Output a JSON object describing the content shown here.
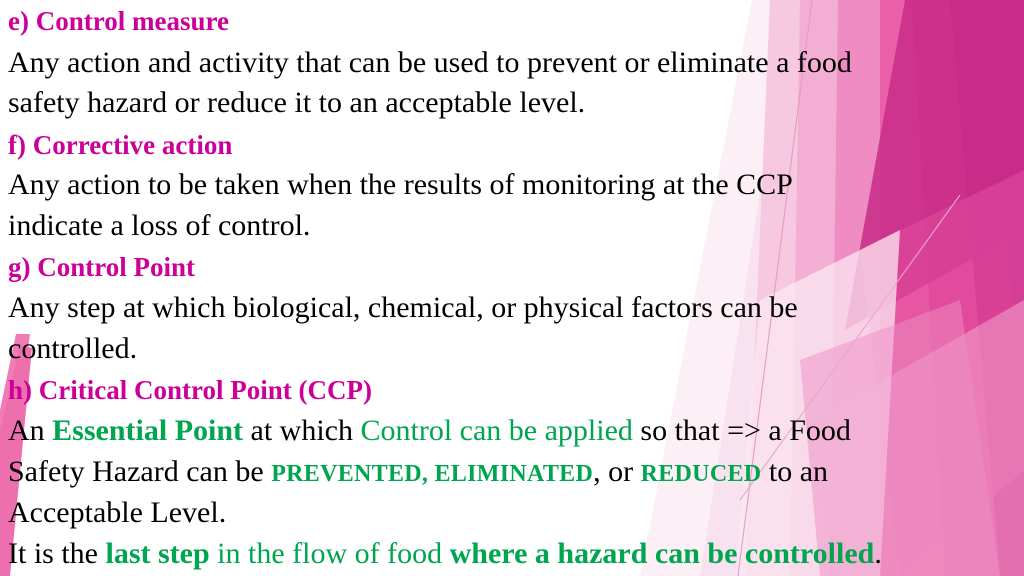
{
  "slide": {
    "background_color": "#ffffff",
    "heading_color": "#CC0099",
    "body_color": "#000000",
    "accent_green": "#00A550",
    "decoration_colors": {
      "pale_pink": "#F7DCEA",
      "light_pink": "#F4AFD2",
      "mid_pink": "#EE8CC3",
      "pink": "#E85FA9",
      "hot_pink": "#E0469C",
      "magenta": "#D52F90",
      "deep_magenta": "#C42A8A",
      "dark_magenta": "#BA1F80",
      "hairline": "#E6A9C8",
      "left_wedge": "#F07CB5"
    }
  },
  "lines": [
    {
      "id": "line-e-heading",
      "name": "heading-control-measure",
      "type": "heading",
      "text": "e) Control measure"
    },
    {
      "id": "line-e-body-1",
      "name": "body-control-measure-1",
      "type": "body",
      "text": " Any action and activity that can be used to prevent or eliminate a food"
    },
    {
      "id": "line-e-body-2",
      "name": "body-control-measure-2",
      "type": "body",
      "text": "safety hazard or reduce it to an acceptable level."
    },
    {
      "id": "line-f-heading",
      "name": "heading-corrective-action",
      "type": "heading",
      "text": "f) Corrective action"
    },
    {
      "id": "line-f-body-1",
      "name": "body-corrective-action-1",
      "type": "body",
      "text": "Any action to be taken when the results of monitoring at the CCP"
    },
    {
      "id": "line-f-body-2",
      "name": "body-corrective-action-2",
      "type": "body",
      "text": "indicate a loss of control."
    },
    {
      "id": "line-g-heading",
      "name": "heading-control-point",
      "type": "heading",
      "text": "g) Control Point"
    },
    {
      "id": "line-g-body-1",
      "name": "body-control-point-1",
      "type": "body",
      "text": "Any step at which biological, chemical, or physical factors can be"
    },
    {
      "id": "line-g-body-2",
      "name": "body-control-point-2",
      "type": "body",
      "text": "controlled."
    },
    {
      "id": "line-h-heading",
      "name": "heading-critical-control-point",
      "type": "heading",
      "text": "h) Critical Control Point (CCP)"
    }
  ],
  "rich_lines": {
    "ccp_line_1": {
      "name": "body-ccp-essential-point",
      "segments": [
        {
          "text": "An ",
          "style": "plain"
        },
        {
          "text": "Essential Point",
          "style": "green-bold"
        },
        {
          "text": " at which ",
          "style": "plain"
        },
        {
          "text": "Control can be applied",
          "style": "green"
        },
        {
          "text": " so that => a Food",
          "style": "plain"
        }
      ]
    },
    "ccp_line_2": {
      "name": "body-ccp-hazard-actions",
      "segments": [
        {
          "text": "Safety Hazard can be ",
          "style": "plain"
        },
        {
          "text": "PREVENTED, ELIMINATED",
          "style": "green-smallcaps"
        },
        {
          "text": ", or ",
          "style": "plain"
        },
        {
          "text": "REDUCED",
          "style": "green-smallcaps"
        },
        {
          "text": " to an",
          "style": "plain"
        }
      ]
    },
    "ccp_line_3": {
      "name": "body-ccp-acceptable-level",
      "segments": [
        {
          "text": "Acceptable Level.",
          "style": "plain"
        }
      ]
    },
    "ccp_line_4": {
      "name": "body-ccp-last-step",
      "segments": [
        {
          "text": "It is the ",
          "style": "plain"
        },
        {
          "text": "last step",
          "style": "green-bold"
        },
        {
          "text": " in the flow of food ",
          "style": "green"
        },
        {
          "text": "where a hazard can be controlled",
          "style": "green-bold"
        },
        {
          "text": ".",
          "style": "plain"
        }
      ]
    }
  }
}
